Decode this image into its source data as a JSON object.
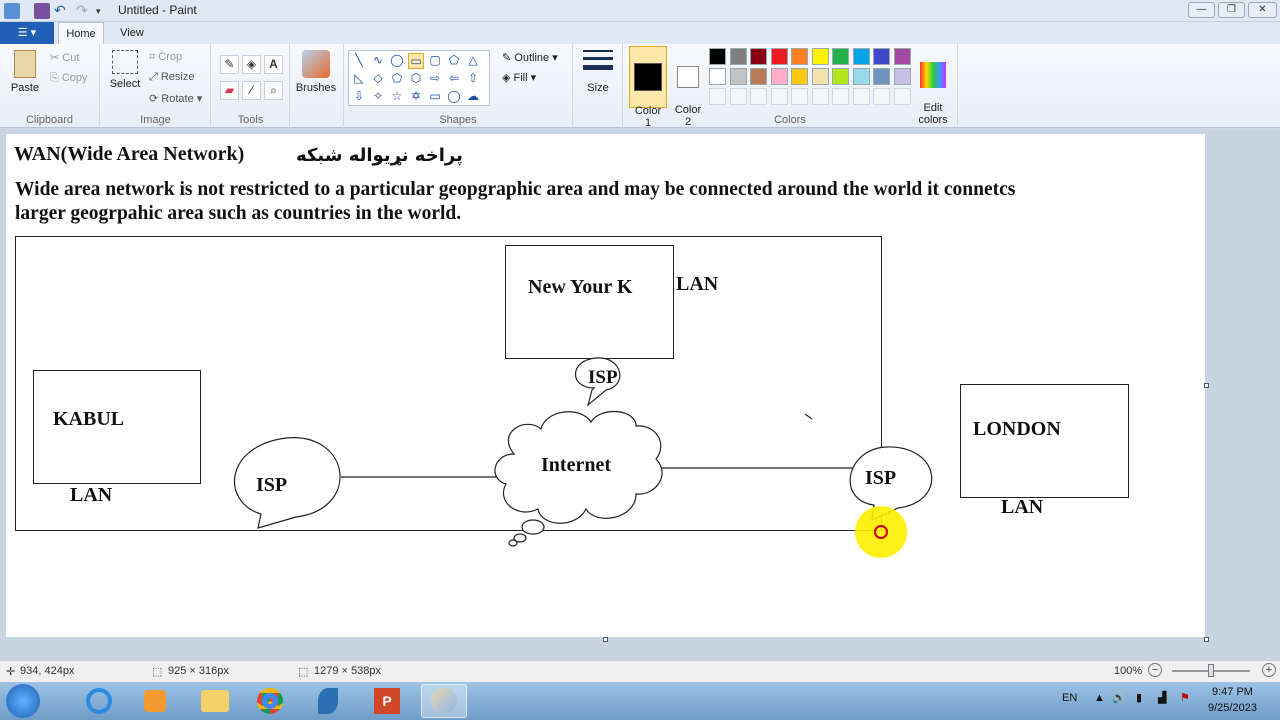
{
  "window": {
    "title": "Untitled - Paint"
  },
  "tabs": {
    "file": "☰ ▾",
    "home": "Home",
    "view": "View"
  },
  "clipboard": {
    "paste": "Paste",
    "cut": "Cut",
    "copy": "Copy",
    "label": "Clipboard"
  },
  "image": {
    "select": "Select",
    "crop": "Crop",
    "resize": "Resize",
    "rotate": "Rotate",
    "label": "Image"
  },
  "tools": {
    "label": "Tools",
    "items": [
      "pencil-icon",
      "fill-icon",
      "text-icon",
      "eraser-icon",
      "color-picker-icon",
      "magnifier-icon"
    ]
  },
  "shapes": {
    "label": "Shapes",
    "outline": "Outline",
    "fill": "Fill"
  },
  "brushes": {
    "label": "Brushes"
  },
  "size": {
    "label": "Size"
  },
  "colors": {
    "color1": "Color\n1",
    "color2": "Color\n2",
    "label": "Colors",
    "edit": "Edit\ncolors",
    "color1_value": "#000000",
    "color2_value": "#ffffff",
    "palette_row1": [
      "#000000",
      "#7f7f7f",
      "#880015",
      "#ed1c24",
      "#ff7f27",
      "#fff200",
      "#22b14c",
      "#00a2e8",
      "#3f48cc",
      "#a349a4"
    ],
    "palette_row2": [
      "#ffffff",
      "#c3c3c3",
      "#b97a57",
      "#ffaec9",
      "#ffc90e",
      "#efe4b0",
      "#b5e61d",
      "#99d9ea",
      "#7092be",
      "#c8bfe7"
    ]
  },
  "canvas": {
    "heading": "WAN(Wide Area Network)",
    "heading_pashto": "پراخه نړیواله شبکه",
    "paragraph_line1": "Wide area network is not restricted to a particular geopgraphic area and may be connected around the world it connetcs",
    "paragraph_line2": "larger geogrpahic area such as countries in the world.",
    "new_york": "New Your K",
    "lan_top": "LAN",
    "isp_top": "ISP",
    "kabul": "KABUL",
    "lan_left": "LAN",
    "isp_left": "ISP",
    "internet": "Internet",
    "isp_right": "ISP",
    "london": "LONDON",
    "lan_right": "LAN"
  },
  "status": {
    "cursor": "934, 424px",
    "selection": "925 × 316px",
    "canvas_size": "1279 × 538px",
    "zoom": "100%"
  },
  "taskbar": {
    "lang": "EN",
    "time": "9:47 PM",
    "date": "9/25/2023"
  }
}
